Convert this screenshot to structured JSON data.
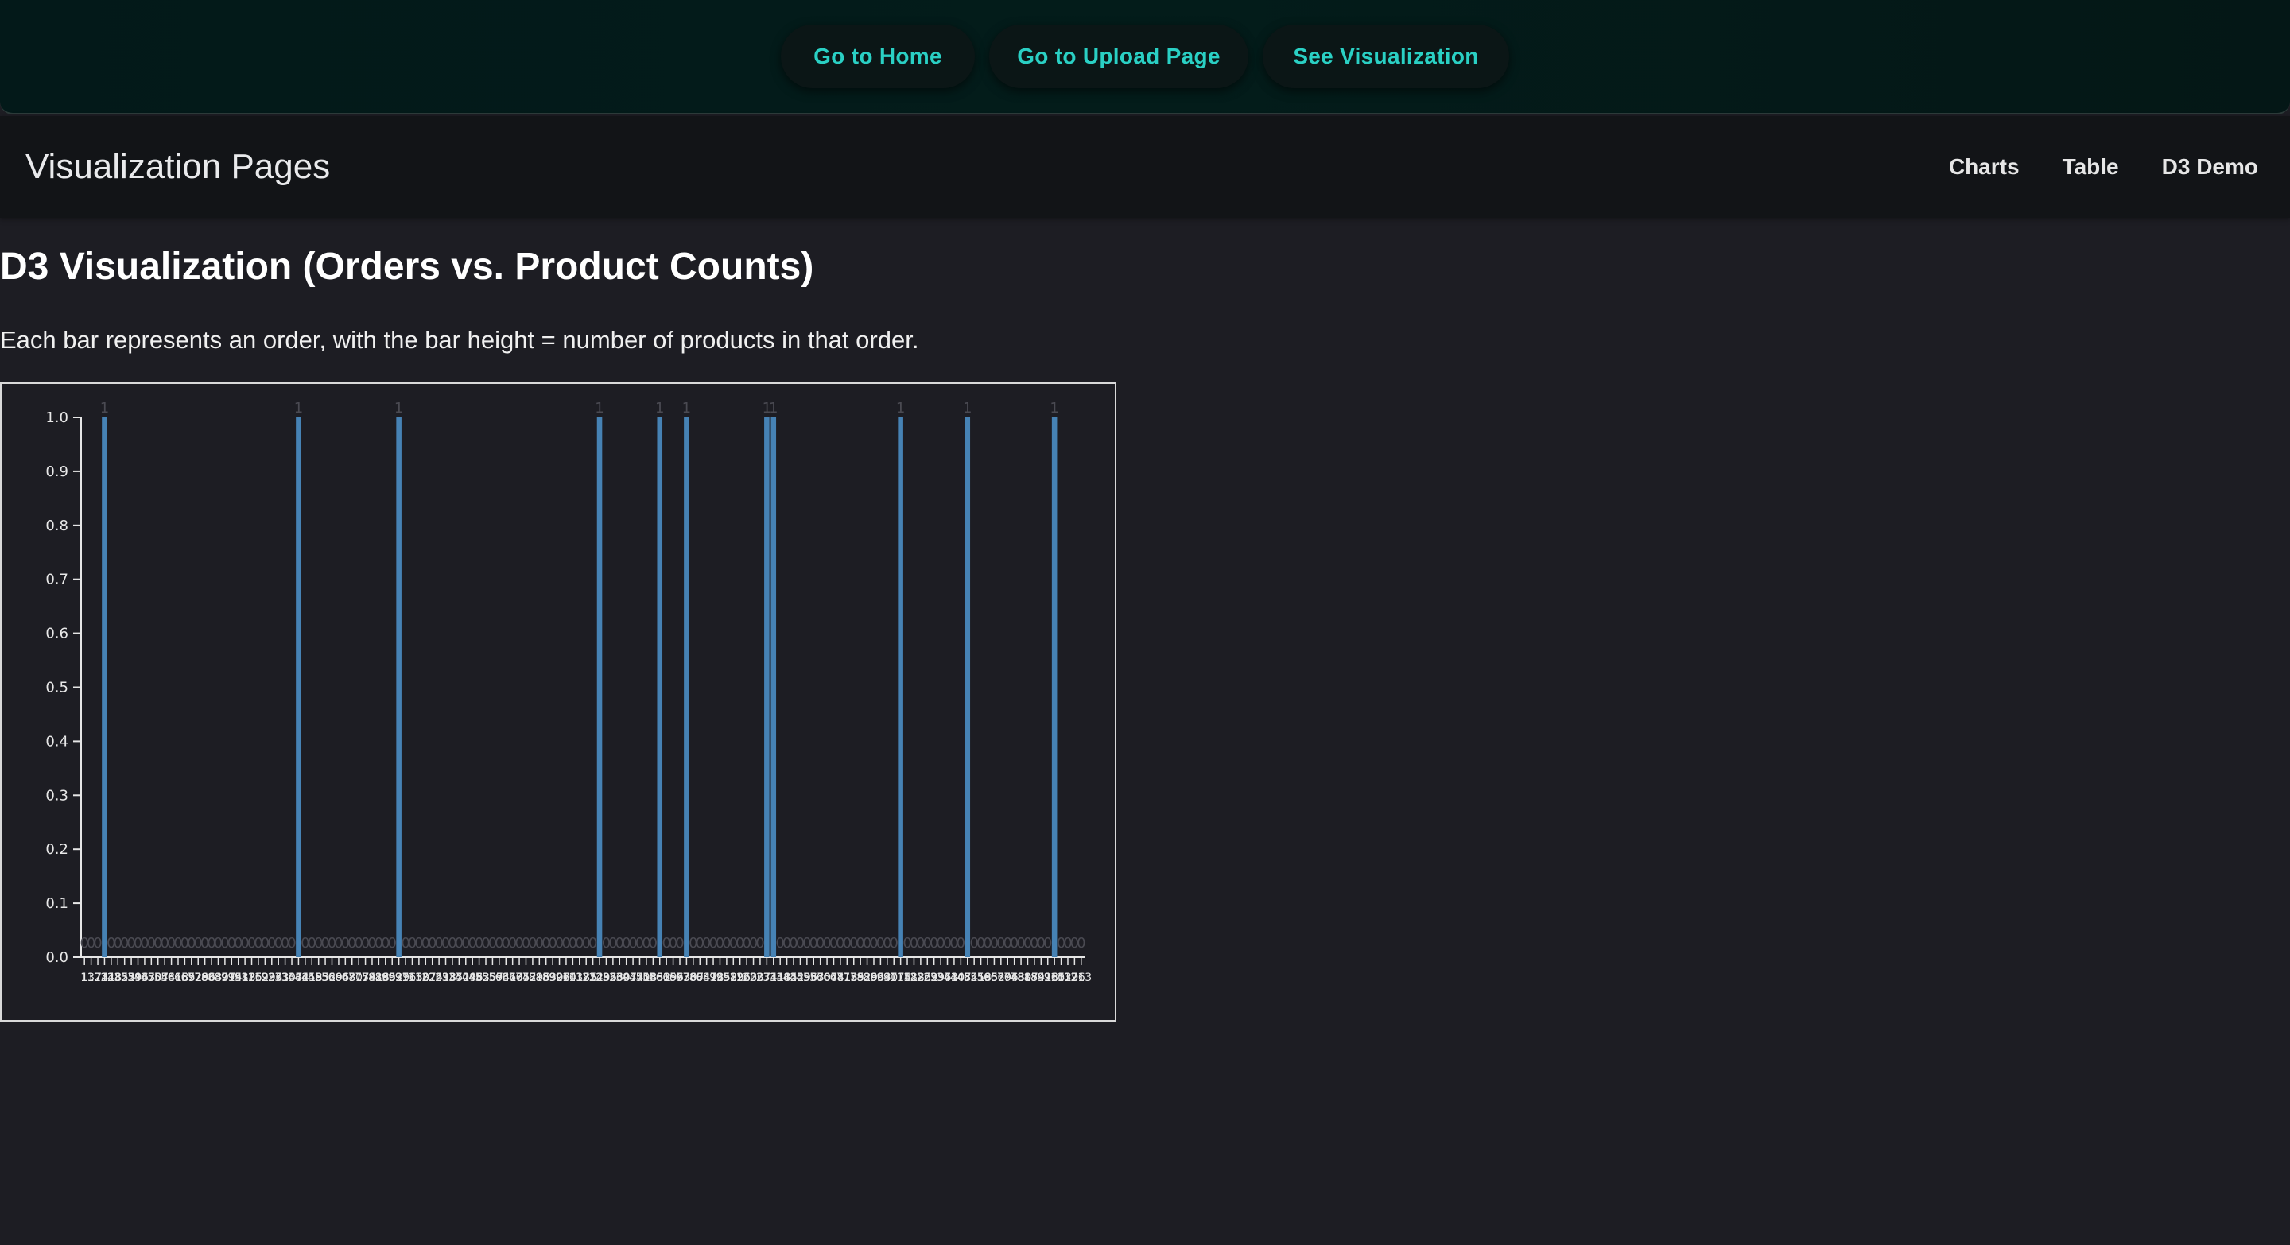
{
  "top_nav": {
    "buttons": [
      {
        "label": "Go to Home"
      },
      {
        "label": "Go to Upload Page"
      },
      {
        "label": "See Visualization"
      }
    ]
  },
  "appbar": {
    "title": "Visualization Pages",
    "links": [
      {
        "label": "Charts"
      },
      {
        "label": "Table"
      },
      {
        "label": "D3 Demo"
      }
    ]
  },
  "main": {
    "heading": "D3 Visualization (Orders vs. Product Counts)",
    "description": "Each bar represents an order, with the bar height = number of products in that order."
  },
  "colors": {
    "accent": "#2ad0c4",
    "bar": "#4682b4",
    "background": "#1d1d23"
  },
  "chart_data": {
    "type": "bar",
    "ylim": [
      0,
      1
    ],
    "yticks": [
      "0.0",
      "0.1",
      "0.2",
      "0.3",
      "0.4",
      "0.5",
      "0.6",
      "0.7",
      "0.8",
      "0.9",
      "1.0"
    ],
    "category_count": 150,
    "visible_bars": [
      {
        "index": 3,
        "value": 1,
        "label": "1"
      },
      {
        "index": 32,
        "value": 1,
        "label": "1"
      },
      {
        "index": 47,
        "value": 1,
        "label": "1"
      },
      {
        "index": 77,
        "value": 1,
        "label": "1"
      },
      {
        "index": 86,
        "value": 1,
        "label": "1"
      },
      {
        "index": 90,
        "value": 1,
        "label": "1"
      },
      {
        "index": 102,
        "value": 1,
        "label": "1"
      },
      {
        "index": 103,
        "value": 1,
        "label": "1"
      },
      {
        "index": 122,
        "value": 1,
        "label": "1"
      },
      {
        "index": 132,
        "value": 1,
        "label": "1"
      },
      {
        "index": 145,
        "value": 1,
        "label": "1"
      }
    ],
    "zero_value": 0,
    "zero_label": "0",
    "first_tick_label": "1"
  }
}
